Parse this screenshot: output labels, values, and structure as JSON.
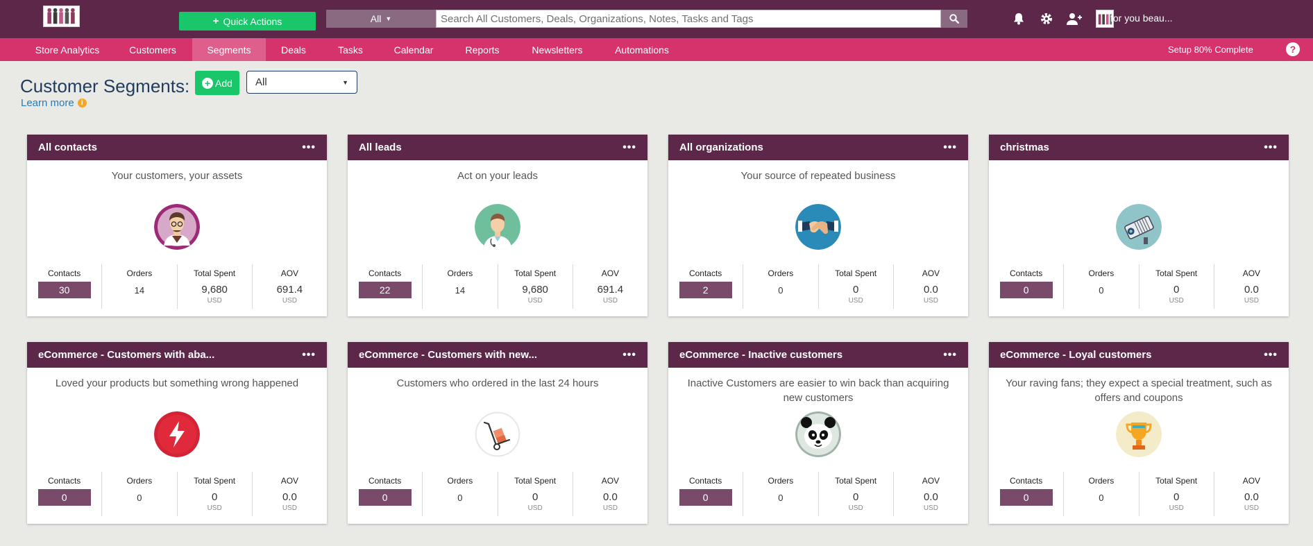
{
  "header": {
    "quick_actions_label": "Quick Actions",
    "search_filter": "All",
    "search_placeholder": "Search All Customers, Deals, Organizations, Notes, Tasks and Tags",
    "store_name": "for you beau..."
  },
  "nav": {
    "items": [
      {
        "label": "Store Analytics"
      },
      {
        "label": "Customers"
      },
      {
        "label": "Segments",
        "active": true
      },
      {
        "label": "Deals"
      },
      {
        "label": "Tasks"
      },
      {
        "label": "Calendar"
      },
      {
        "label": "Reports"
      },
      {
        "label": "Newsletters"
      },
      {
        "label": "Automations"
      }
    ],
    "setup_label": "Setup 80% Complete",
    "help_label": "?"
  },
  "page": {
    "title": "Customer Segments:",
    "add_label": "Add",
    "filter_value": "All",
    "learn_more": "Learn more"
  },
  "stat_labels": {
    "contacts": "Contacts",
    "orders": "Orders",
    "total_spent": "Total Spent",
    "aov": "AOV",
    "unit": "USD"
  },
  "segments": [
    {
      "title": "All contacts",
      "desc": "Your customers, your assets",
      "icon": "man-avatar-icon",
      "contacts": "30",
      "orders": "14",
      "total_spent": "9,680",
      "aov": "691.4"
    },
    {
      "title": "All leads",
      "desc": "Act on your leads",
      "icon": "doctor-avatar-icon",
      "contacts": "22",
      "orders": "14",
      "total_spent": "9,680",
      "aov": "691.4"
    },
    {
      "title": "All organizations",
      "desc": "Your source of repeated business",
      "icon": "handshake-icon",
      "contacts": "2",
      "orders": "0",
      "total_spent": "0",
      "aov": "0.0"
    },
    {
      "title": "christmas",
      "desc": "",
      "icon": "security-camera-icon",
      "contacts": "0",
      "orders": "0",
      "total_spent": "0",
      "aov": "0.0"
    },
    {
      "title": "eCommerce - Customers with aba...",
      "desc": "Loved your products but something wrong happened",
      "icon": "lightning-icon",
      "contacts": "0",
      "orders": "0",
      "total_spent": "0",
      "aov": "0.0"
    },
    {
      "title": "eCommerce - Customers with new...",
      "desc": "Customers who ordered in the last 24 hours",
      "icon": "hand-truck-icon",
      "contacts": "0",
      "orders": "0",
      "total_spent": "0",
      "aov": "0.0"
    },
    {
      "title": "eCommerce - Inactive customers",
      "desc": "Inactive Customers are easier to win back than acquiring new customers",
      "icon": "panda-icon",
      "contacts": "0",
      "orders": "0",
      "total_spent": "0",
      "aov": "0.0"
    },
    {
      "title": "eCommerce - Loyal customers",
      "desc": "Your raving fans; they expect a special treatment, such as offers and coupons",
      "icon": "trophy-icon",
      "contacts": "0",
      "orders": "0",
      "total_spent": "0",
      "aov": "0.0"
    }
  ],
  "colors": {
    "topbar": "#5c2749",
    "navbar": "#d6336c",
    "accent_green": "#19c76a",
    "card_header": "#5c2749",
    "contacts_box": "#7a4a6a",
    "background": "#e9e9e6"
  }
}
